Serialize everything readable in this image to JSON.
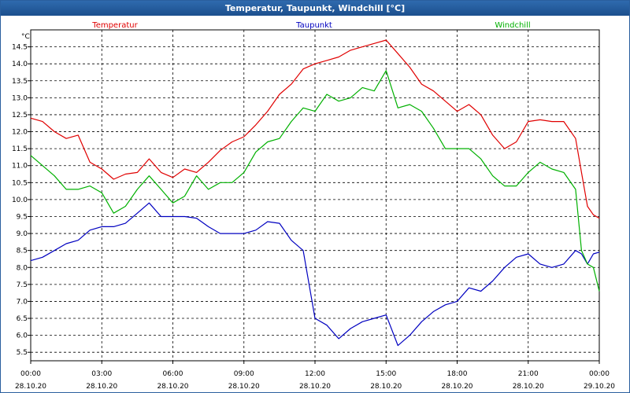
{
  "window": {
    "title": "Temperatur, Taupunkt, Windchill [°C]"
  },
  "chart_data": {
    "type": "line",
    "title": "Temperatur, Taupunkt, Windchill [°C]",
    "ylabel": "°C",
    "xlabel": "",
    "ylim": [
      5.25,
      15.0
    ],
    "xlim": [
      0,
      24
    ],
    "grid": true,
    "legend_placement": "top",
    "y_ticks": [
      "5.5",
      "6.0",
      "6.5",
      "7.0",
      "7.5",
      "8.0",
      "8.5",
      "9.0",
      "9.5",
      "10.0",
      "10.5",
      "11.0",
      "11.5",
      "12.0",
      "12.5",
      "13.0",
      "13.5",
      "14.0",
      "14.5"
    ],
    "x_ticks": [
      {
        "time": "00:00",
        "date": "28.10.20"
      },
      {
        "time": "03:00",
        "date": "28.10.20"
      },
      {
        "time": "06:00",
        "date": "28.10.20"
      },
      {
        "time": "09:00",
        "date": "28.10.20"
      },
      {
        "time": "12:00",
        "date": "28.10.20"
      },
      {
        "time": "15:00",
        "date": "28.10.20"
      },
      {
        "time": "18:00",
        "date": "28.10.20"
      },
      {
        "time": "21:00",
        "date": "28.10.20"
      },
      {
        "time": "00:00",
        "date": "29.10.20"
      }
    ],
    "x": [
      0,
      0.5,
      1,
      1.5,
      2,
      2.5,
      3,
      3.5,
      4,
      4.5,
      5,
      5.5,
      6,
      6.5,
      7,
      7.5,
      8,
      8.5,
      9,
      9.5,
      10,
      10.5,
      11,
      11.5,
      12,
      12.5,
      13,
      13.5,
      14,
      14.5,
      15,
      15.5,
      16,
      16.5,
      17,
      17.5,
      18,
      18.5,
      19,
      19.5,
      20,
      20.5,
      21,
      21.5,
      22,
      22.5,
      23,
      23.25,
      23.5,
      23.75,
      24
    ],
    "series": [
      {
        "name": "Temperatur",
        "color": "#e00000",
        "values": [
          12.4,
          12.3,
          12.0,
          11.8,
          11.9,
          11.1,
          10.9,
          10.6,
          10.75,
          10.8,
          11.2,
          10.8,
          10.65,
          10.9,
          10.8,
          11.1,
          11.45,
          11.7,
          11.85,
          12.2,
          12.6,
          13.1,
          13.4,
          13.85,
          14.0,
          14.1,
          14.2,
          14.4,
          14.5,
          14.6,
          14.7,
          14.3,
          13.9,
          13.4,
          13.2,
          12.9,
          12.6,
          12.8,
          12.5,
          11.9,
          11.5,
          11.7,
          12.3,
          12.35,
          12.3,
          12.3,
          11.8,
          10.8,
          9.8,
          9.55,
          9.45
        ]
      },
      {
        "name": "Taupunkt",
        "color": "#0000c0",
        "values": [
          8.2,
          8.3,
          8.5,
          8.7,
          8.8,
          9.1,
          9.2,
          9.2,
          9.3,
          9.6,
          9.9,
          9.5,
          9.5,
          9.5,
          9.45,
          9.2,
          9.0,
          9.0,
          9.0,
          9.1,
          9.35,
          9.3,
          8.8,
          8.5,
          6.5,
          6.3,
          5.9,
          6.2,
          6.4,
          6.5,
          6.6,
          5.7,
          6.0,
          6.4,
          6.7,
          6.9,
          7.0,
          7.4,
          7.3,
          7.6,
          8.0,
          8.3,
          8.4,
          8.1,
          8.0,
          8.1,
          8.5,
          8.4,
          8.1,
          8.4,
          8.45
        ]
      },
      {
        "name": "Windchill",
        "color": "#00b000",
        "values": [
          11.3,
          11.0,
          10.7,
          10.3,
          10.3,
          10.4,
          10.2,
          9.6,
          9.8,
          10.3,
          10.7,
          10.3,
          9.9,
          10.1,
          10.7,
          10.3,
          10.5,
          10.5,
          10.8,
          11.4,
          11.7,
          11.8,
          12.3,
          12.7,
          12.6,
          13.1,
          12.9,
          13.0,
          13.3,
          13.2,
          13.8,
          12.7,
          12.8,
          12.6,
          12.1,
          11.5,
          11.5,
          11.5,
          11.2,
          10.7,
          10.4,
          10.4,
          10.8,
          11.1,
          10.9,
          10.8,
          10.3,
          8.5,
          8.1,
          8.0,
          7.3
        ]
      }
    ]
  }
}
